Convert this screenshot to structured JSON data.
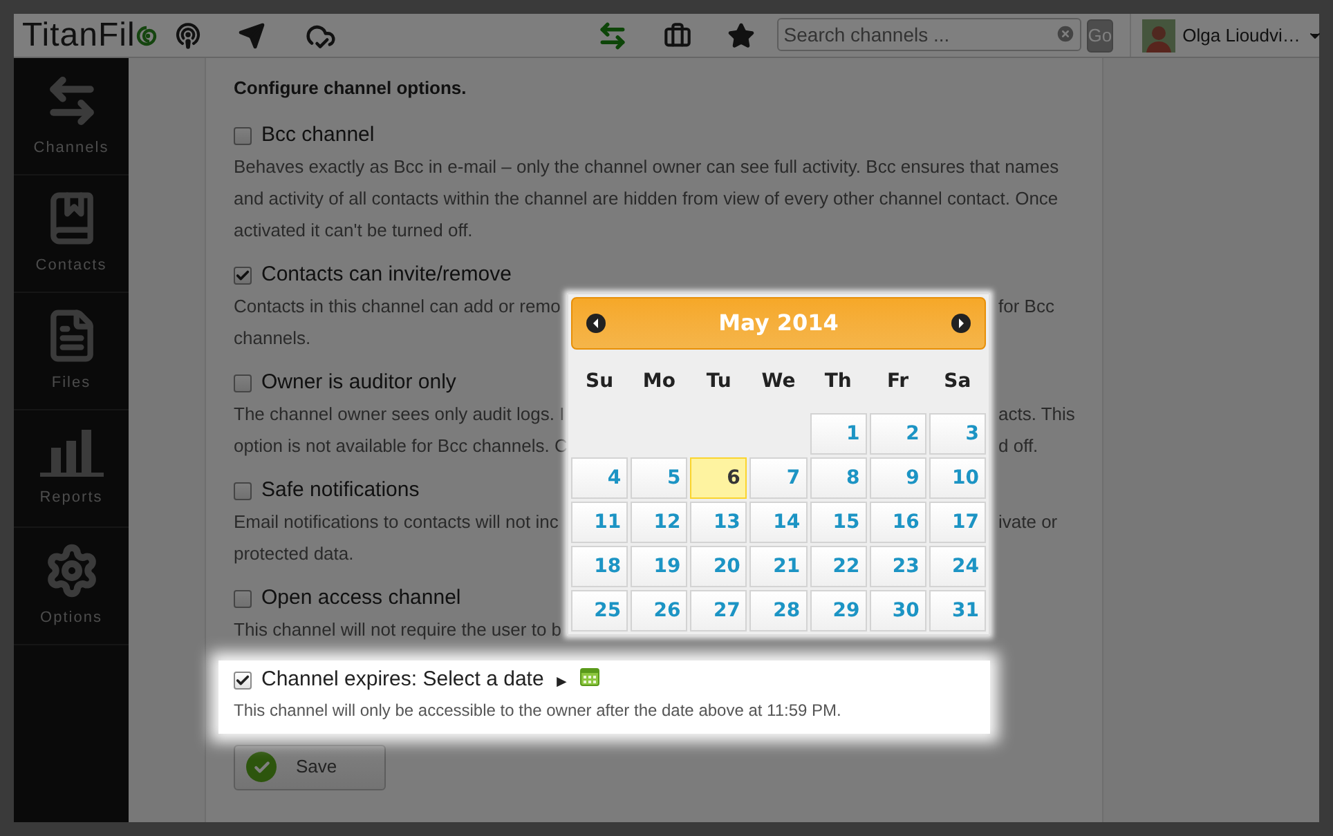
{
  "topbar": {
    "logo": "TitanFil",
    "search": {
      "placeholder": "Search channels ..."
    },
    "go_button": "Go",
    "user": "Olga Lioudvi…"
  },
  "sidebar": {
    "items": [
      {
        "label": "Channels",
        "kind": "arrows",
        "selected": false
      },
      {
        "label": "Contacts",
        "kind": "book",
        "selected": false
      },
      {
        "label": "Files",
        "kind": "file",
        "selected": false
      },
      {
        "label": "Reports",
        "kind": "chart",
        "selected": false
      },
      {
        "label": "Options",
        "kind": "gear",
        "selected": false
      }
    ]
  },
  "options": {
    "heading": "Configure channel options.",
    "items": [
      {
        "label": "Bcc channel",
        "checked": false,
        "lines": [
          {
            "left": "Behaves exactly as Bcc in e-mail – only the channel owner can see full activity. Bcc ensures that names"
          },
          {
            "left": "and activity of all contacts within the channel are hidden from view of every other channel contact. Once"
          },
          {
            "left": "activated it can't be turned off."
          }
        ]
      },
      {
        "label": "Contacts can invite/remove",
        "checked": true,
        "lines": [
          {
            "left": "Contacts in this channel can add or remo",
            "right": "for Bcc"
          },
          {
            "left": "channels."
          }
        ]
      },
      {
        "label": "Owner is auditor only",
        "checked": false,
        "lines": [
          {
            "left": "The channel owner sees only audit logs. I",
            "right": "acts. This"
          },
          {
            "left": "option is not available for Bcc channels. C",
            "right": "d off."
          }
        ]
      },
      {
        "label": "Safe notifications",
        "checked": false,
        "lines": [
          {
            "left": "Email notifications to contacts will not inc",
            "right": "ivate or"
          },
          {
            "left": "protected data."
          }
        ]
      },
      {
        "label": "Open access channel",
        "checked": false,
        "lines": [
          {
            "left": "This channel will not require the user to b"
          }
        ]
      }
    ],
    "expires": {
      "label": "Channel expires: Select a date",
      "arrow": "►",
      "checked": true,
      "description": "This channel will only be accessible to the owner after the date above at 11:59 PM."
    },
    "save_button": "Save"
  },
  "calendar": {
    "title": "May 2014",
    "weekdays": [
      "Su",
      "Mo",
      "Tu",
      "We",
      "Th",
      "Fr",
      "Sa"
    ],
    "weeks": [
      [
        {
          "day": "1",
          "selected": false
        },
        {
          "day": "2",
          "selected": false
        },
        {
          "day": "3",
          "selected": false
        }
      ],
      [
        {
          "day": "4",
          "selected": false
        },
        {
          "day": "5",
          "selected": false
        },
        {
          "day": "6",
          "selected": true
        },
        {
          "day": "7",
          "selected": false
        },
        {
          "day": "8",
          "selected": false
        },
        {
          "day": "9",
          "selected": false
        },
        {
          "day": "10",
          "selected": false
        }
      ],
      [
        {
          "day": "11",
          "selected": false
        },
        {
          "day": "12",
          "selected": false
        },
        {
          "day": "13",
          "selected": false
        },
        {
          "day": "14",
          "selected": false
        },
        {
          "day": "15",
          "selected": false
        },
        {
          "day": "16",
          "selected": false
        },
        {
          "day": "17",
          "selected": false
        }
      ],
      [
        {
          "day": "18",
          "selected": false
        },
        {
          "day": "19",
          "selected": false
        },
        {
          "day": "20",
          "selected": false
        },
        {
          "day": "21",
          "selected": false
        },
        {
          "day": "22",
          "selected": false
        },
        {
          "day": "23",
          "selected": false
        },
        {
          "day": "24",
          "selected": false
        }
      ],
      [
        {
          "day": "25",
          "selected": false
        },
        {
          "day": "26",
          "selected": false
        },
        {
          "day": "27",
          "selected": false
        },
        {
          "day": "28",
          "selected": false
        },
        {
          "day": "29",
          "selected": false
        },
        {
          "day": "30",
          "selected": false
        },
        {
          "day": "31",
          "selected": false
        }
      ]
    ]
  }
}
